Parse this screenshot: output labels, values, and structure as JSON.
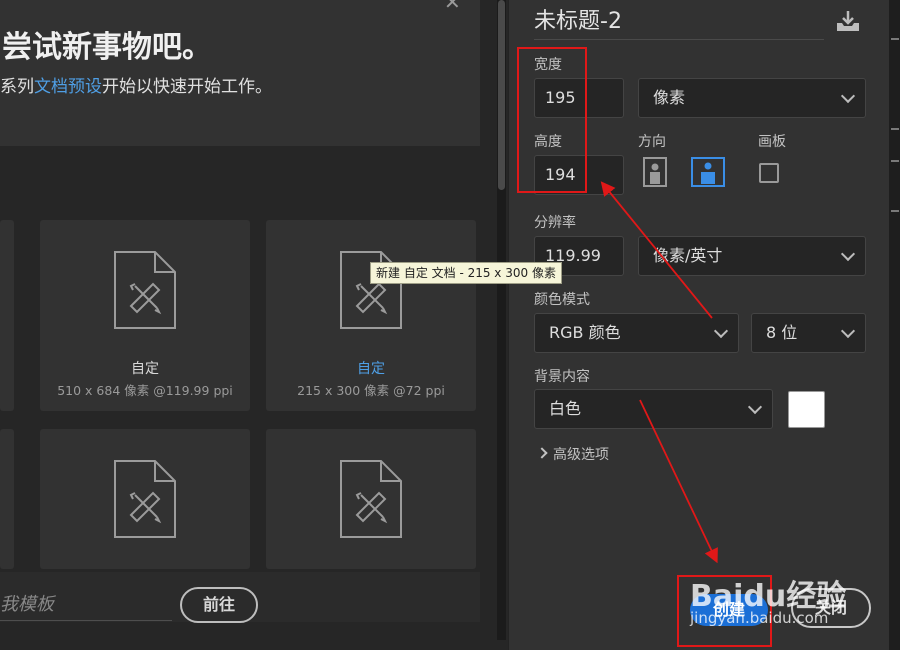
{
  "hero": {
    "title": "尝试新事物吧。",
    "subtitle_prefix": "系列",
    "subtitle_link": "文档预设",
    "subtitle_suffix": "开始以快速开始工作。"
  },
  "presets": [
    {
      "name": "自定",
      "dims": "510 x 684 像素 @119.99 ppi"
    },
    {
      "name": "自定",
      "dims": "215 x 300 像素 @72 ppi"
    }
  ],
  "tooltip": "新建 自定 文档 - 215 x 300 像素",
  "bottom_bar": {
    "search_placeholder": "我模板",
    "go_label": "前往"
  },
  "panel": {
    "doc_title": "未标题-2",
    "width_label": "宽度",
    "width_value": "195",
    "width_unit": "像素",
    "height_label": "高度",
    "height_value": "194",
    "orientation_label": "方向",
    "artboard_label": "画板",
    "resolution_label": "分辨率",
    "resolution_value": "119.99",
    "resolution_unit": "像素/英寸",
    "color_mode_label": "颜色模式",
    "color_mode": "RGB 颜色",
    "bit_depth": "8 位",
    "background_label": "背景内容",
    "background": "白色",
    "advanced_label": "高级选项",
    "create_label": "创建",
    "close_label": "关闭"
  },
  "watermark": {
    "brand": "Baidu经验",
    "url": "jingyan.baidu.com"
  },
  "colors": {
    "accent": "#1b6fd6",
    "link": "#4f9fe5",
    "annotation": "#e01818",
    "swatch": "#ffffff"
  }
}
